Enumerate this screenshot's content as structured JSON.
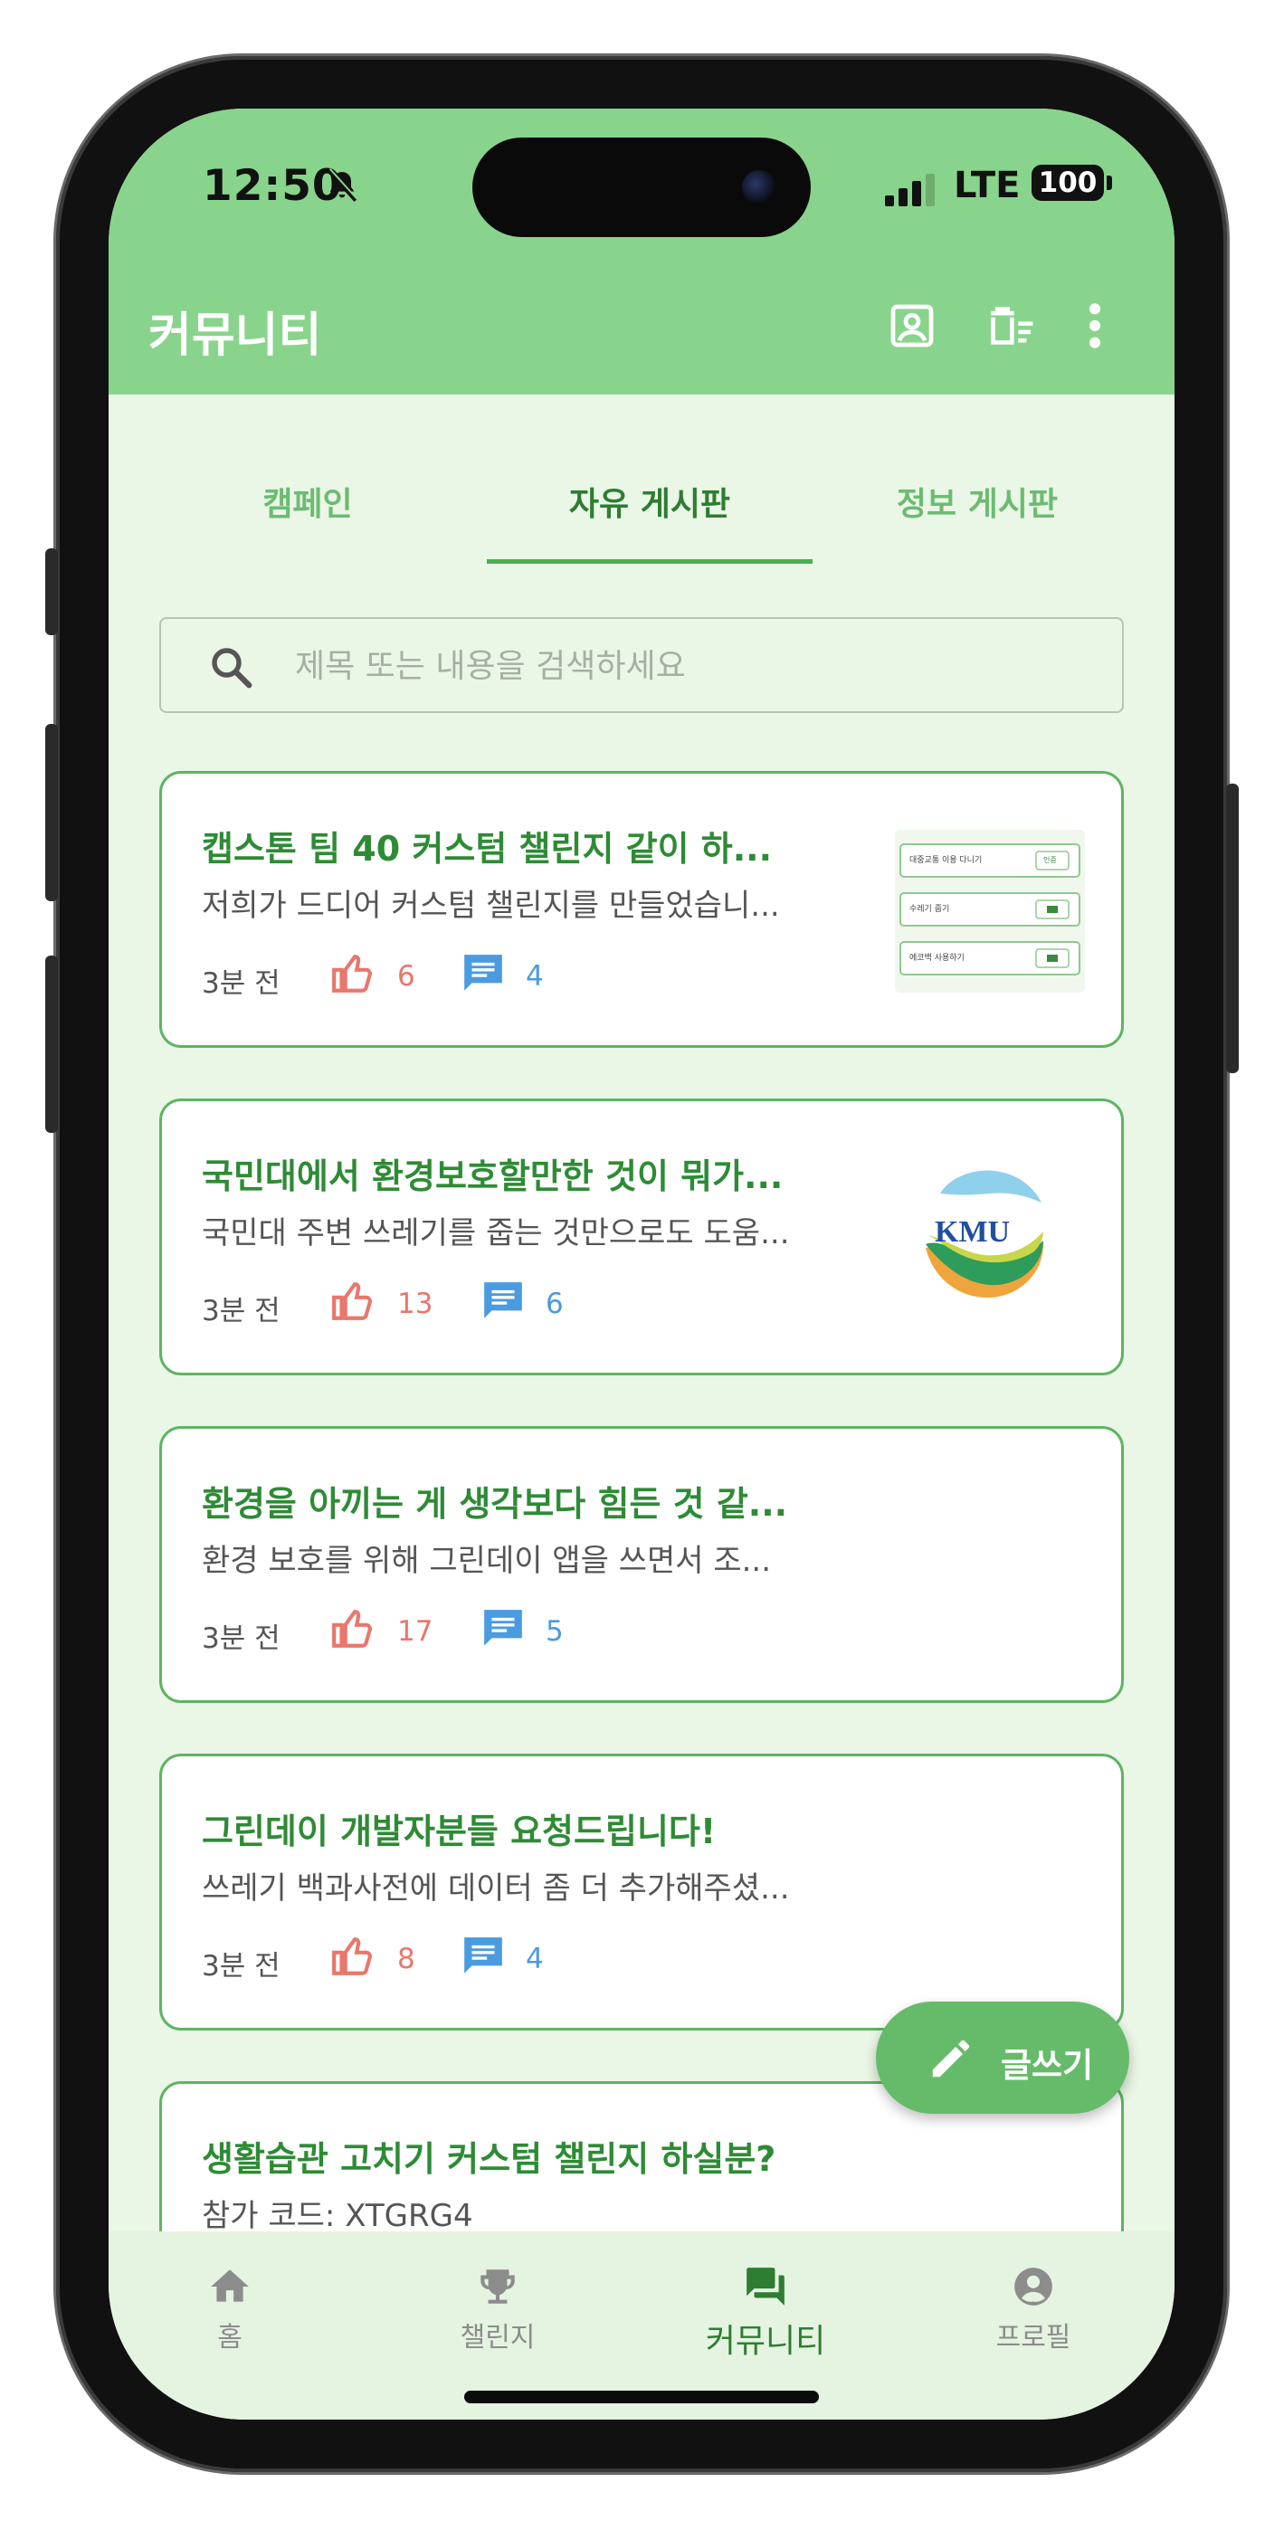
{
  "status_bar": {
    "time": "12:50",
    "network": "LTE",
    "battery": "100"
  },
  "app_bar": {
    "title": "커뮤니티",
    "icons": [
      "profile-card-icon",
      "delete-sort-icon",
      "more-vert-icon"
    ]
  },
  "tabs": [
    {
      "label": "캠페인",
      "active": false
    },
    {
      "label": "자유 게시판",
      "active": true
    },
    {
      "label": "정보 게시판",
      "active": false
    }
  ],
  "search": {
    "placeholder": "제목 또는 내용을 검색하세요",
    "value": ""
  },
  "posts": [
    {
      "title": "캡스톤 팀 40 커스텀 챌린지 같이 하...",
      "body": "저희가 드디어 커스텀 챌린지를 만들었습니...",
      "time": "3분 전",
      "likes": "6",
      "comments": "4",
      "thumbnail": "screenshot"
    },
    {
      "title": "국민대에서 환경보호할만한 것이 뭐가...",
      "body": "국민대 주변 쓰레기를 줍는 것만으로도 도움...",
      "time": "3분 전",
      "likes": "13",
      "comments": "6",
      "thumbnail": "kmu-logo"
    },
    {
      "title": "환경을 아끼는 게 생각보다 힘든 것 같...",
      "body": "환경 보호를 위해 그린데이 앱을 쓰면서 조...",
      "time": "3분 전",
      "likes": "17",
      "comments": "5",
      "thumbnail": ""
    },
    {
      "title": "그린데이 개발자분들 요청드립니다!",
      "body": "쓰레기 백과사전에 데이터 좀 더 추가해주셨...",
      "time": "3분 전",
      "likes": "8",
      "comments": "4",
      "thumbnail": ""
    },
    {
      "title": "생활습관 고치기 커스텀 챌린지 하실분?",
      "body": "참가 코드: XTGRG4",
      "time": "",
      "likes": "",
      "comments": "",
      "thumbnail": ""
    }
  ],
  "thumbnail_texts": {
    "row1": "대중교통 이용 다니기",
    "row1_btn": "인증",
    "row2": "수레기 줍기",
    "row3": "에코백 사용하기",
    "logo": "KMU"
  },
  "fab": {
    "label": "글쓰기",
    "icon": "pencil-icon"
  },
  "bottom_nav": [
    {
      "label": "홈",
      "icon": "home-icon",
      "active": false
    },
    {
      "label": "챌린지",
      "icon": "trophy-icon",
      "active": false
    },
    {
      "label": "커뮤니티",
      "icon": "forum-icon",
      "active": true
    },
    {
      "label": "프로필",
      "icon": "account-circle-icon",
      "active": false
    }
  ],
  "colors": {
    "app_bar": "#89d48c",
    "background": "#eaf6e6",
    "accent": "#4caf50",
    "title_green": "#2e8b35",
    "like": "#e8776c",
    "comment": "#4a9be0"
  }
}
